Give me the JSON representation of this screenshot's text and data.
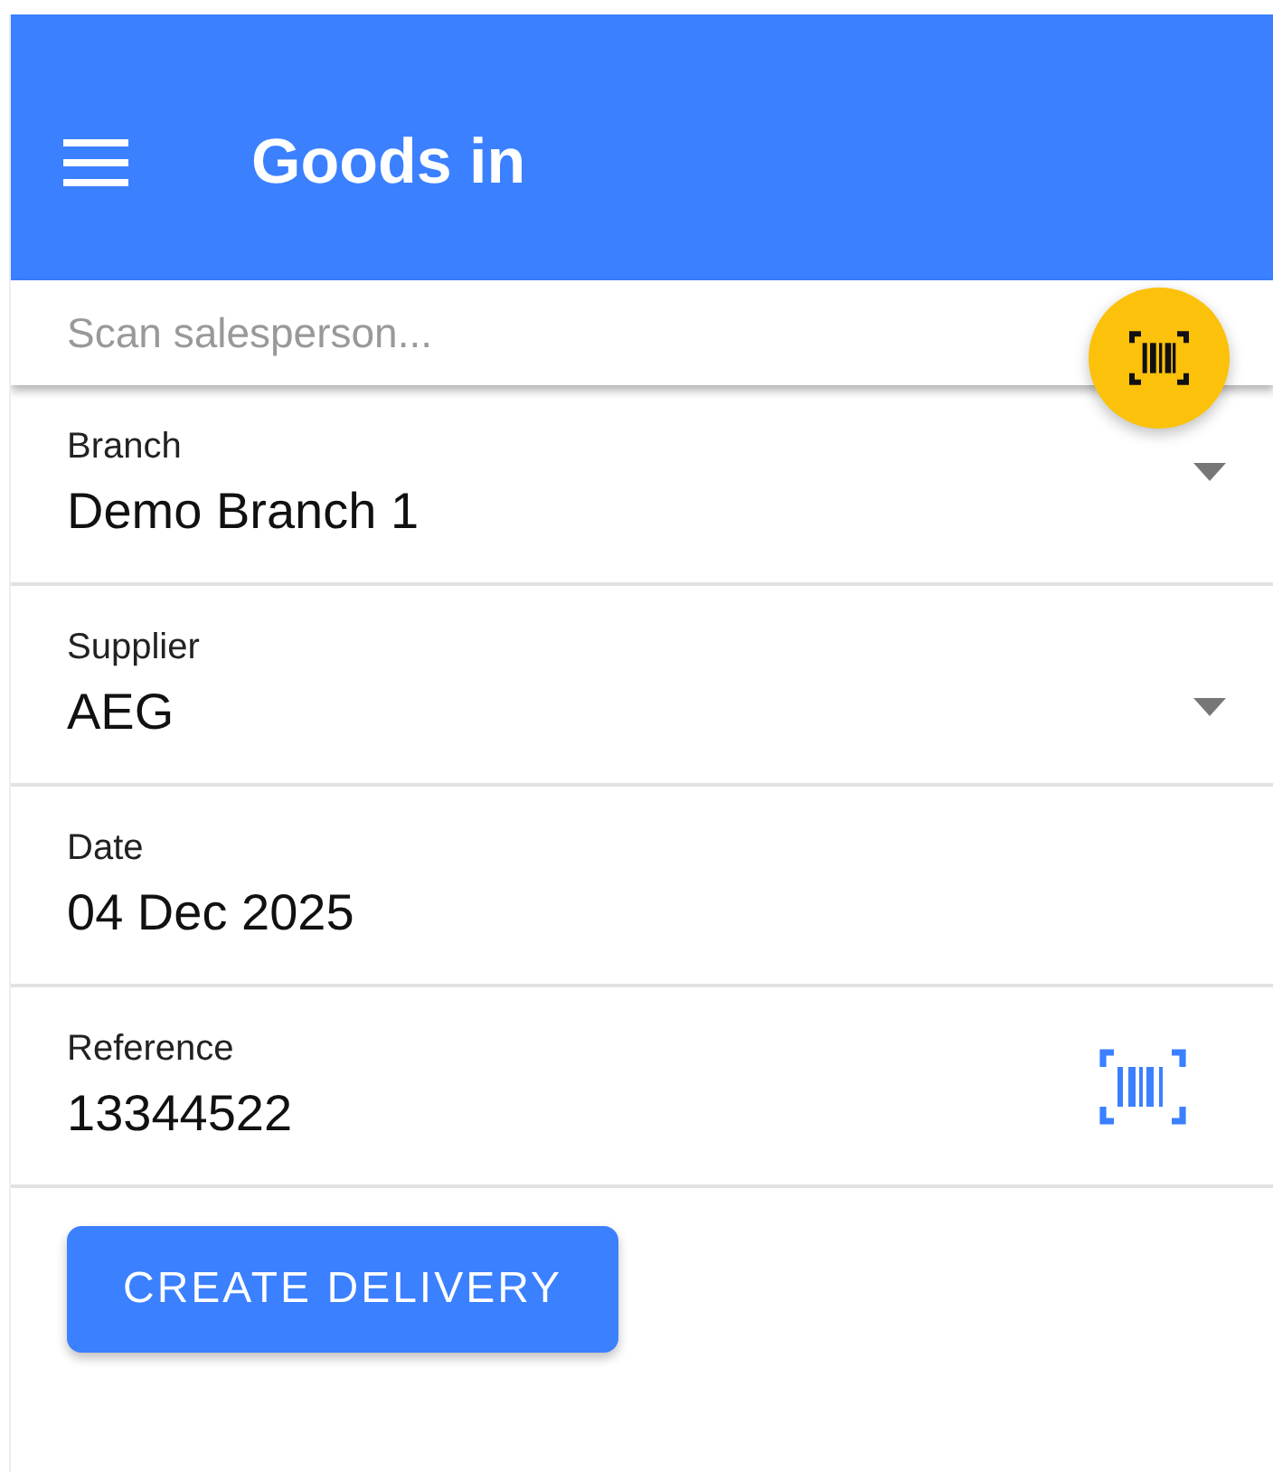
{
  "app_bar": {
    "title": "Goods in"
  },
  "search": {
    "placeholder": "Scan salesperson..."
  },
  "fields": [
    {
      "kind": "select",
      "label": "Branch",
      "value": "Demo Branch 1"
    },
    {
      "kind": "select",
      "label": "Supplier",
      "value": "AEG"
    },
    {
      "kind": "date",
      "label": "Date",
      "value": "04 Dec 2025"
    },
    {
      "kind": "scan",
      "label": "Reference",
      "value": "13344522"
    }
  ],
  "buttons": [
    "CREATE DELIVERY"
  ]
}
